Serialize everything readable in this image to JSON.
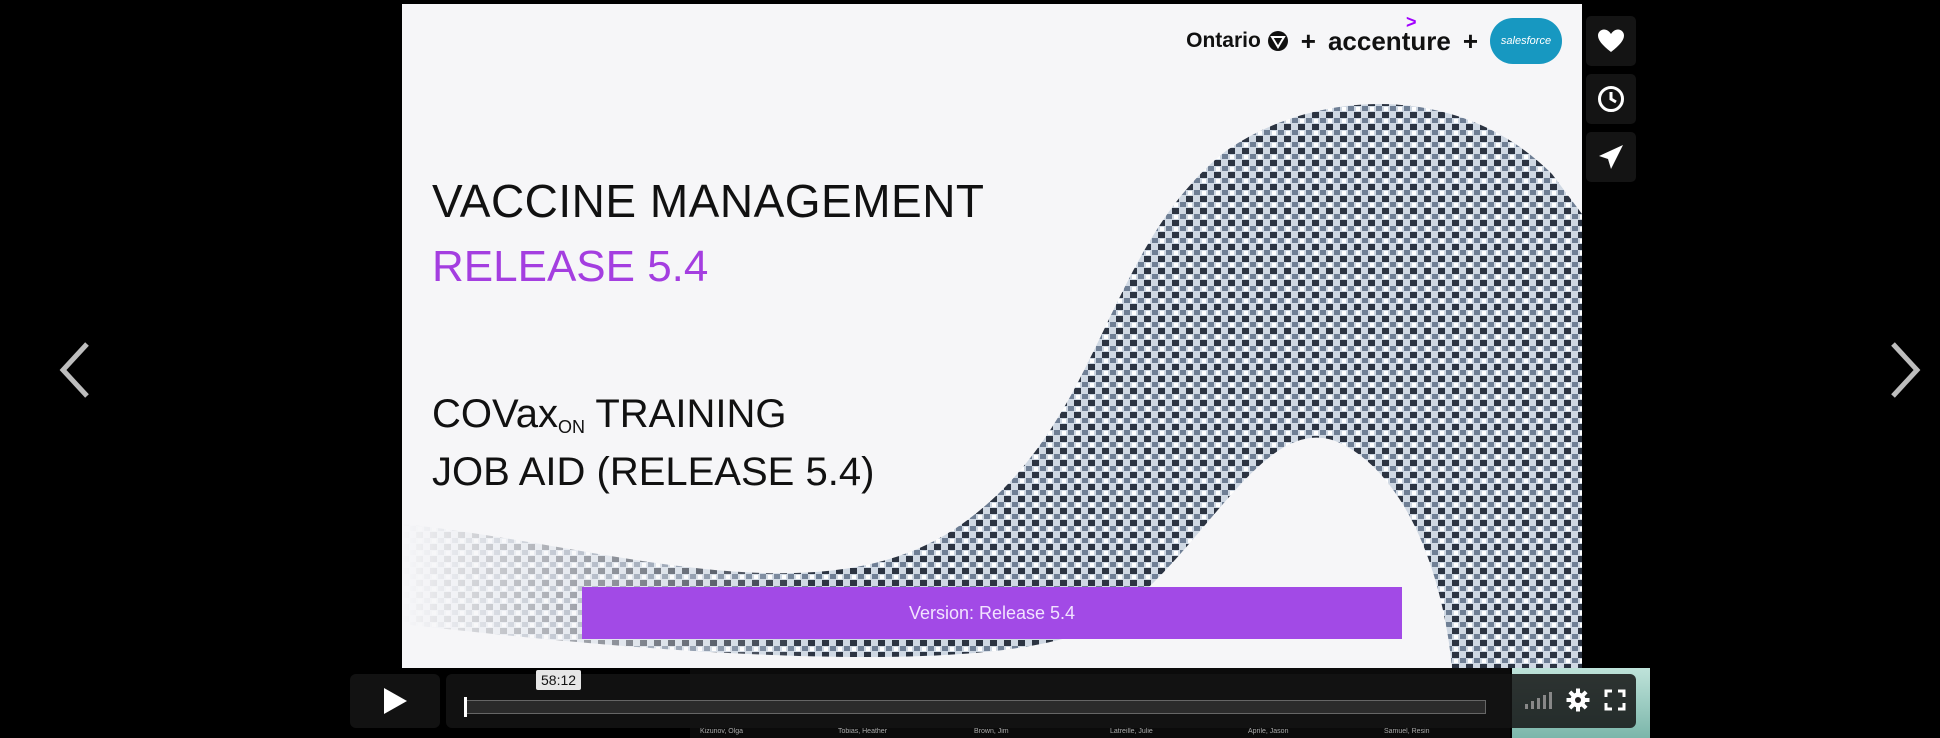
{
  "slide": {
    "logos": {
      "ontario": "Ontario",
      "plus": "+",
      "accenture": "accenture",
      "salesforce": "salesforce"
    },
    "title": "VACCINE MANAGEMENT",
    "release": "RELEASE 5.4",
    "training_prefix": "COVax",
    "training_sub": "ON",
    "training_suffix": " TRAINING",
    "job_aid": "JOB AID (RELEASE 5.4)",
    "version_bar": "Version: Release 5.4",
    "accent_color": "#a43ee0"
  },
  "side_buttons": [
    {
      "icon": "heart-icon"
    },
    {
      "icon": "clock-icon"
    },
    {
      "icon": "paper-plane-icon"
    }
  ],
  "player": {
    "time_tooltip": "58:12",
    "progress": 0.0,
    "icons": [
      "volume-icon",
      "gear-icon",
      "fullscreen-icon"
    ]
  },
  "gallery_names": [
    "Kizunov, Olga",
    "Tobias, Heather",
    "Brown, Jim",
    "Latreille, Julie",
    "Aprile, Jason",
    "Samuel, Resin"
  ]
}
